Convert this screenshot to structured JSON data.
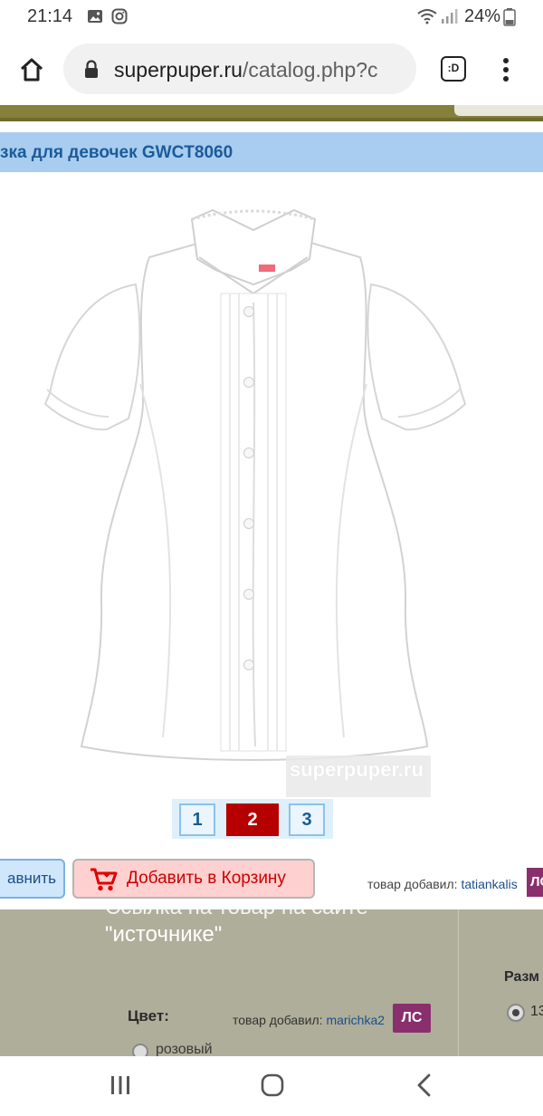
{
  "status_bar": {
    "time": "21:14",
    "battery": "24%",
    "icons": [
      "gallery-icon",
      "instagram-icon",
      "wifi-icon",
      "signal-icon",
      "battery-icon"
    ]
  },
  "browser": {
    "url_host": "superpuper.ru",
    "url_path": "/catalog.php?c",
    "icons": [
      "home-icon",
      "lock-icon",
      "tab-switcher-icon",
      "more-menu-icon"
    ],
    "tab_label": ":D"
  },
  "product": {
    "title": "зка для девочек GWCT8060",
    "watermark": "superpuper.ru",
    "pages": [
      "1",
      "2",
      "3"
    ],
    "active_page": "2"
  },
  "actions": {
    "compare_label": "авнить",
    "cart_label": "Добавить в Корзину",
    "added_by_prefix": "товар добавил:",
    "added_by_user": "tatiankalis",
    "badge": "ЛС"
  },
  "lower_panel": {
    "text_cut": "Ссылка на товар на сайте",
    "text_main": "\"источнике\"",
    "size_label": "Разм",
    "size_value": "13",
    "color_label": "Цвет:",
    "added_by_prefix": "товар добавил:",
    "added_by_user": "marichka2",
    "badge": "ЛС",
    "color_value": "розовый"
  },
  "nav": {
    "icons": [
      "recent-apps-icon",
      "home-button-icon",
      "back-icon"
    ]
  },
  "colors": {
    "title_bar": "#a8cdf0",
    "active_page": "#b60000",
    "cart_bg": "#ffd0d0",
    "cart_text": "#cc0000",
    "badge": "#8a2f6e",
    "panel": "#aeae9a"
  }
}
